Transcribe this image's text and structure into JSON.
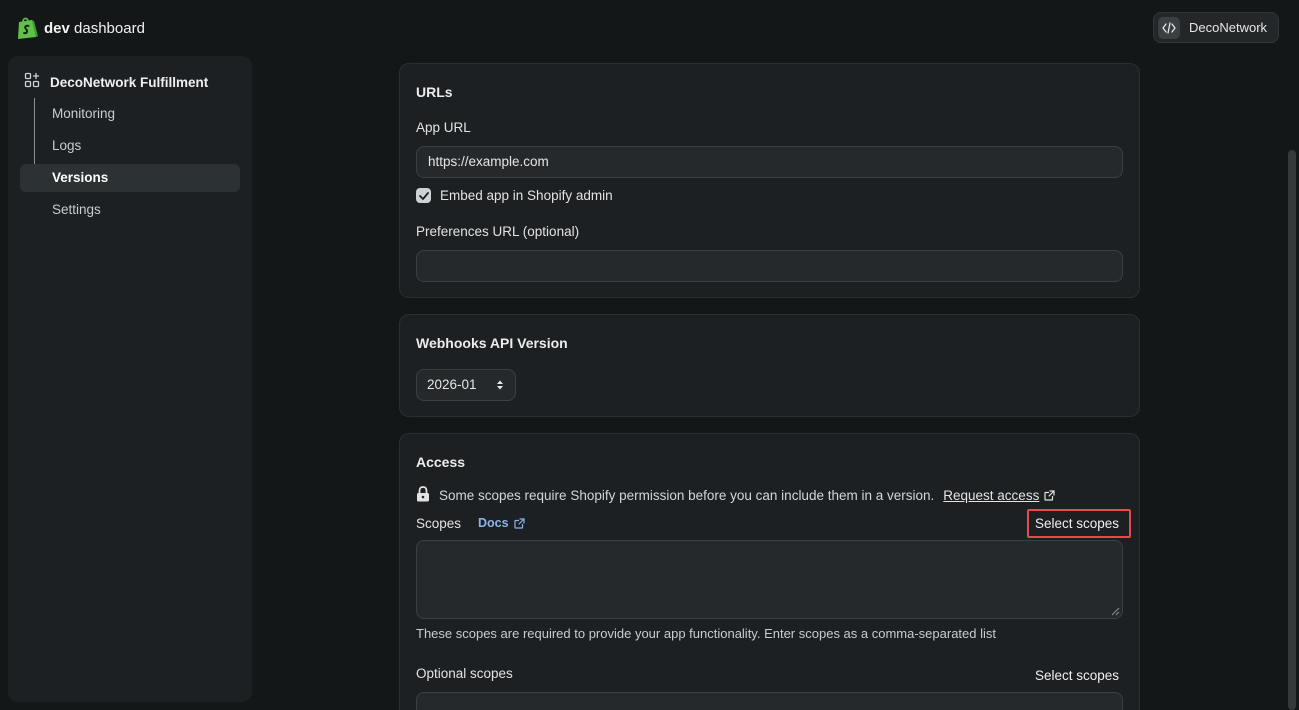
{
  "topbar": {
    "brand_bold": "dev",
    "brand_rest": "dashboard",
    "org_name": "DecoNetwork"
  },
  "sidebar": {
    "app_name": "DecoNetwork Fulfillment",
    "items": [
      {
        "label": "Monitoring",
        "active": false
      },
      {
        "label": "Logs",
        "active": false
      },
      {
        "label": "Versions",
        "active": true
      },
      {
        "label": "Settings",
        "active": false
      }
    ]
  },
  "urls_card": {
    "title": "URLs",
    "app_url_label": "App URL",
    "app_url_value": "https://example.com",
    "embed_label": "Embed app in Shopify admin",
    "embed_checked": true,
    "preferences_label": "Preferences URL (optional)",
    "preferences_value": ""
  },
  "webhooks_card": {
    "title": "Webhooks API Version",
    "selected_version": "2026-01"
  },
  "access_card": {
    "title": "Access",
    "notice_text": "Some scopes require Shopify permission before you can include them in a version.",
    "request_access_label": "Request access",
    "scopes_label": "Scopes",
    "docs_label": "Docs",
    "select_scopes_label": "Select scopes",
    "scopes_help": "These scopes are required to provide your app functionality. Enter scopes as a comma-separated list",
    "optional_scopes_label": "Optional scopes",
    "optional_select_scopes_label": "Select scopes"
  },
  "colors": {
    "highlight": "#e5484d",
    "link_blue": "#8ab4e8",
    "shopify_green": "#5ec248"
  }
}
